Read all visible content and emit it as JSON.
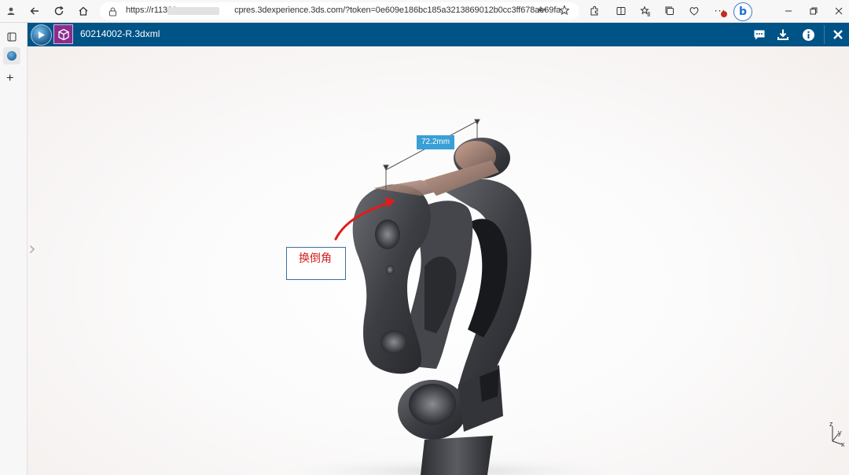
{
  "browser": {
    "url_start": "https://r11321",
    "url_end": "cpres.3dexperience.3ds.com/?token=0e609e186bc185a3213869012b0cc3ff678ae69fa..."
  },
  "app": {
    "file_title": "60214002-R.3dxml"
  },
  "viewer": {
    "dimension_label": "72.2mm",
    "annotation_text": "换倒角",
    "axis_labels": {
      "z": "z",
      "y": "y",
      "x": "x"
    }
  },
  "colors": {
    "app_header": "#005386",
    "dimension_badge": "#3a9fd6",
    "annotation_text": "#d22020",
    "annotation_arrow": "#e21b1b"
  }
}
